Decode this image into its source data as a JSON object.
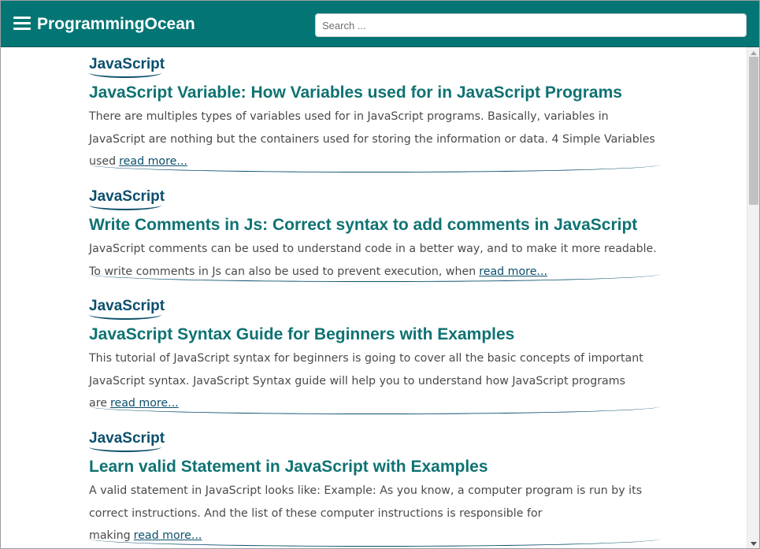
{
  "header": {
    "brand": "ProgrammingOcean",
    "menu_icon": "hamburger-menu-icon",
    "search_placeholder": "Search ...",
    "background_color": "#037575"
  },
  "posts": [
    {
      "category": "JavaScript",
      "title": "JavaScript Variable: How Variables used for in JavaScript Programs",
      "excerpt": "There are multiples types of variables used for in JavaScript programs. Basically, variables in JavaScript are nothing but the containers used for storing the information or data. 4 Simple Variables used",
      "read_more": "read more..."
    },
    {
      "category": "JavaScript",
      "title": "Write Comments in Js: Correct syntax to add comments in JavaScript",
      "excerpt": "JavaScript comments can be used to understand code in a better way, and to make it more readable. To write comments in Js can also be used to prevent execution, when",
      "read_more": "read more..."
    },
    {
      "category": "JavaScript",
      "title": "JavaScript Syntax Guide for Beginners with Examples",
      "excerpt": "This tutorial of JavaScript syntax for beginners is going to cover all the basic concepts of important JavaScript syntax. JavaScript Syntax guide will help you to understand how JavaScript programs are",
      "read_more": "read more..."
    },
    {
      "category": "JavaScript",
      "title": "Learn valid Statement in JavaScript with Examples",
      "excerpt": "A valid statement in JavaScript looks like: Example: As you know, a computer program is run by its correct instructions. And the list of these computer instructions is responsible for making",
      "read_more": "read more..."
    }
  ],
  "colors": {
    "title": "#0f7272",
    "category": "#0c4f6c",
    "text": "#4a4a4a"
  }
}
